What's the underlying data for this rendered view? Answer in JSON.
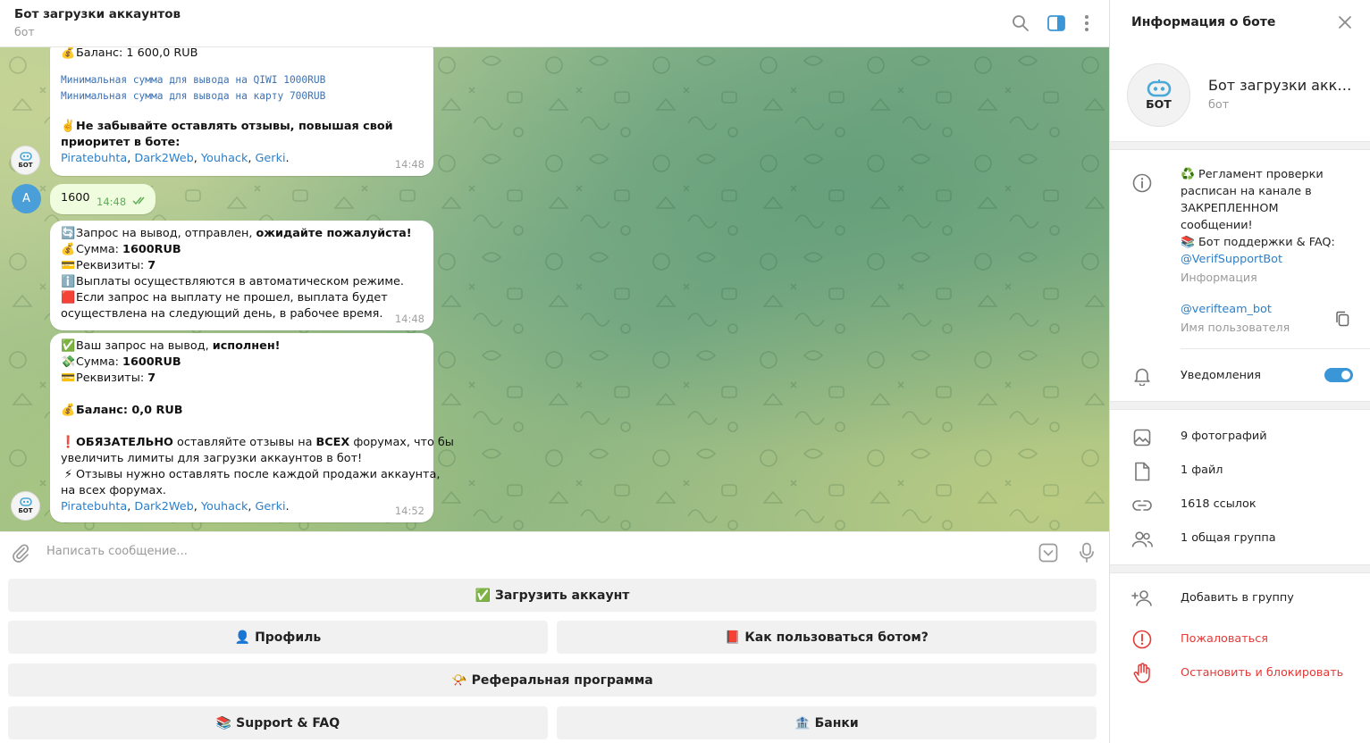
{
  "chat": {
    "title": "Бот загрузки аккаунтов",
    "subtitle": "бот",
    "composer_placeholder": "Написать сообщение..."
  },
  "messages": {
    "m1": {
      "balance_label": "Баланс: 1 600,0 RUB",
      "min_qiwi": "Минимальная сумма для вывода на QIWI 1000RUB",
      "min_card": "Минимальная сумма для вывода на карту 700RUB",
      "review_line1": "Не забывайте оставлять отзывы, повышая свой",
      "review_line2": "приоритет в боте:",
      "links": [
        "Piratebuhta",
        "Dark2Web",
        "Youhack",
        "Gerki"
      ],
      "time": "14:48"
    },
    "m2": {
      "avatar_letter": "A",
      "text": "1600",
      "time": "14:48"
    },
    "m3": {
      "line1_plain": "Запрос на вывод,  отправлен, ",
      "line1_bold": "ожидайте пожалуйста!",
      "sum_label": "Сумма: ",
      "sum_value": "1600RUB",
      "req_label": "Реквизиты: ",
      "req_value": "7",
      "auto_line": "Выплаты осуществляются в автоматическом режиме.",
      "fail_line1": "Если запрос на выплату не прошел, выплата будет",
      "fail_line2": "осуществлена на следующий день, в рабочее время.",
      "time": "14:48"
    },
    "m4": {
      "done_plain": "Ваш запрос на вывод, ",
      "done_bold": "исполнен!",
      "sum_label": "Сумма: ",
      "sum_value": "1600RUB",
      "req_label": "Реквизиты: ",
      "req_value": "7",
      "balance": "Баланс: 0,0 RUB",
      "must_bold": "ОБЯЗАТЕЛЬНО",
      "must_plain1": " оставляйте отзывы на ",
      "must_bold2": "ВСЕХ",
      "must_plain2": " форумах, что бы",
      "must_line2": "увеличить лимиты для загрузки аккаунтов в бот!",
      "after_line1": "Отзывы нужно оставлять после каждой продажи аккаунта,",
      "after_line2": "на всех форумах.",
      "links": [
        "Piratebuhta",
        "Dark2Web",
        "Youhack",
        "Gerki"
      ],
      "time": "14:52"
    },
    "bot_avatar_text": "БОТ"
  },
  "keyboard": {
    "upload": "✅ Загрузить аккаунт",
    "profile": "👤 Профиль",
    "howto": "📕 Как пользоваться ботом?",
    "referral": "📯 Реферальная программа",
    "support": "📚 Support & FAQ",
    "banks": "🏦 Банки"
  },
  "info": {
    "title": "Информация о боте",
    "name": "Бот загрузки аккаунтов",
    "subtitle": "бот",
    "avatar_text": "БОТ",
    "about_lines": [
      "♻️ Регламент проверки",
      "расписан на канале в",
      "ЗАКРЕПЛЕННОМ",
      "сообщении!",
      "📚 Бот поддержки & FAQ:"
    ],
    "about_link": "@VerifSupportBot",
    "about_label": "Информация",
    "username": "@verifteam_bot",
    "username_label": "Имя пользователя",
    "notifications": "Уведомления",
    "notifications_on": true,
    "media": [
      "9 фотографий",
      "1 файл",
      "1618 ссылок",
      "1 общая группа"
    ],
    "add_group": "Добавить в группу",
    "report": "Пожаловаться",
    "block": "Остановить и блокировать"
  },
  "colors": {
    "accent": "#3b96d8",
    "link": "#2d7fc7",
    "danger": "#e53935",
    "outgoing": "#effdde"
  }
}
